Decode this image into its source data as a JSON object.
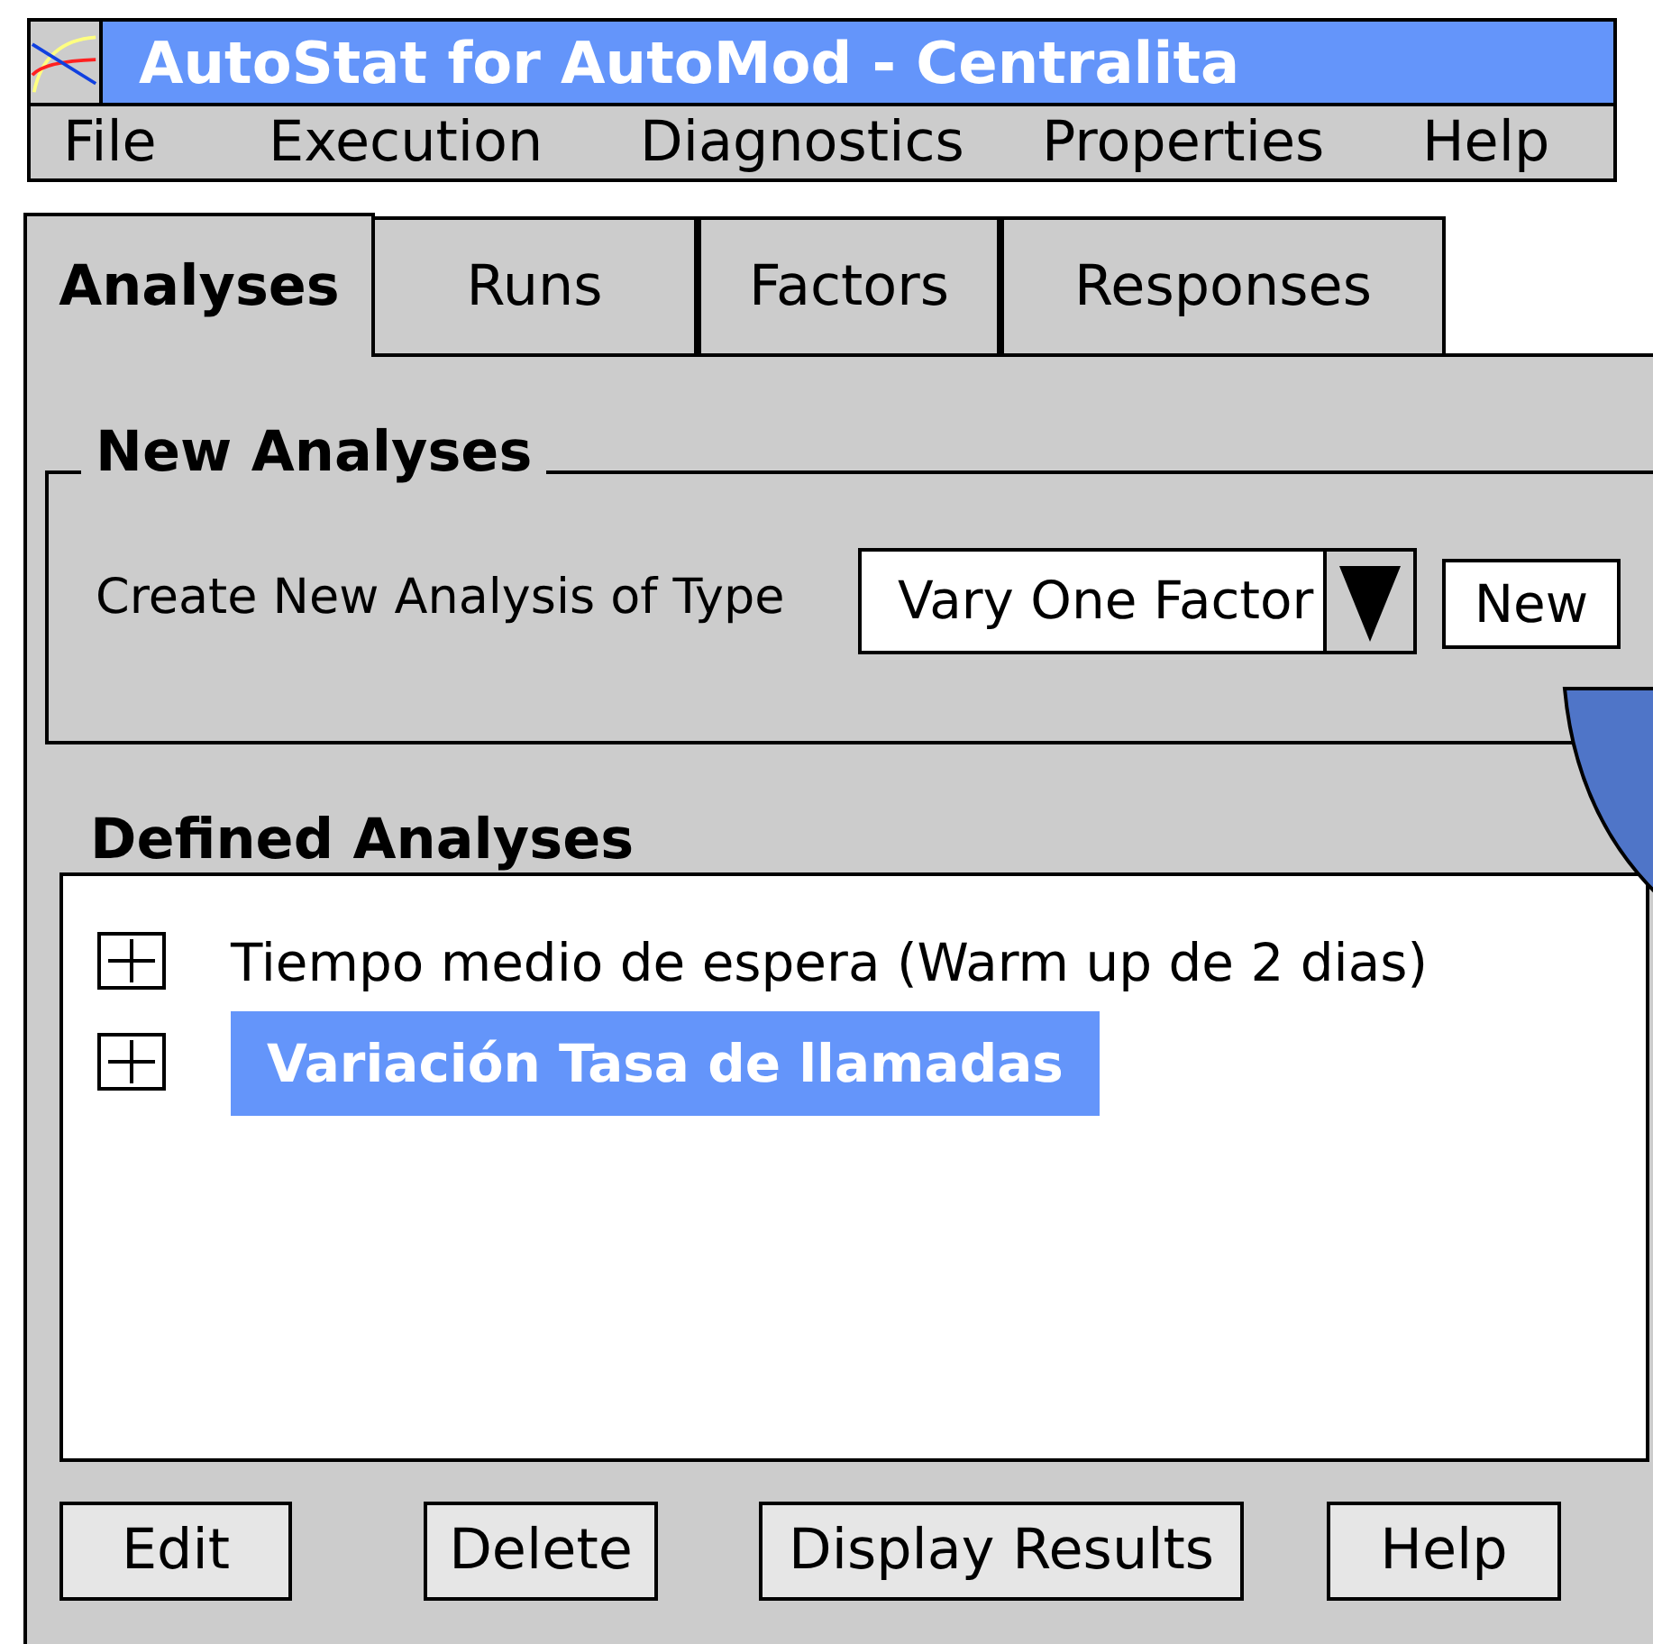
{
  "window": {
    "title": "AutoStat for AutoMod - Centralita"
  },
  "menu": [
    "File",
    "Execution",
    "Diagnostics",
    "Properties",
    "Help"
  ],
  "tabs": [
    {
      "label": "Analyses",
      "selected": true
    },
    {
      "label": "Runs",
      "selected": false
    },
    {
      "label": "Factors",
      "selected": false
    },
    {
      "label": "Responses",
      "selected": false
    }
  ],
  "new_analyses": {
    "title": "New Analyses",
    "label": "Create New Analysis of Type",
    "type_value": "Vary One Factor",
    "button": "New"
  },
  "defined_analyses": {
    "title": "Defined Analyses",
    "items": [
      {
        "label": "Tiempo medio de espera (Warm up de 2 dias)",
        "selected": false,
        "expanded": false
      },
      {
        "label": "Variación Tasa de llamadas",
        "selected": true,
        "expanded": false
      }
    ]
  },
  "buttons": [
    "Edit",
    "Delete",
    "Display Results",
    "Help"
  ]
}
